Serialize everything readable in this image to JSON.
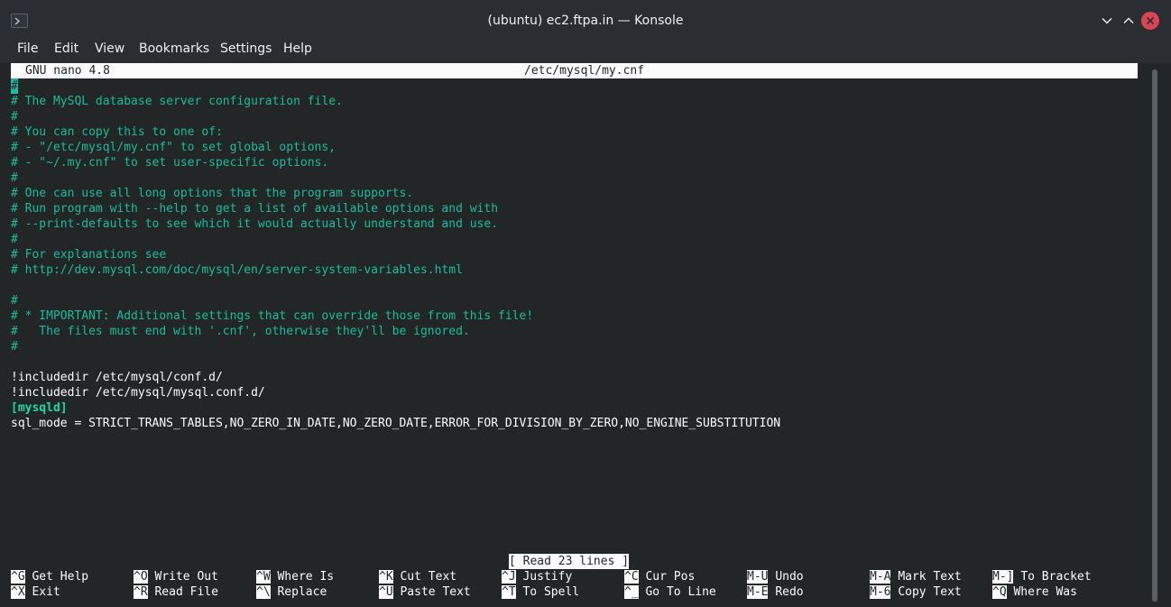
{
  "window": {
    "title": "(ubuntu) ec2.ftpa.in — Konsole"
  },
  "menu": [
    "File",
    "Edit",
    "View",
    "Bookmarks",
    "Settings",
    "Help"
  ],
  "nano": {
    "version": "GNU nano 4.8",
    "filename": "/etc/mysql/my.cnf",
    "status_message": "[ Read 23 lines ]"
  },
  "file_lines": {
    "l1": "#",
    "l2": "# The MySQL database server configuration file.",
    "l3": "#",
    "l4": "# You can copy this to one of:",
    "l5": "# - \"/etc/mysql/my.cnf\" to set global options,",
    "l6": "# - \"~/.my.cnf\" to set user-specific options.",
    "l7": "#",
    "l8": "# One can use all long options that the program supports.",
    "l9": "# Run program with --help to get a list of available options and with",
    "l10": "# --print-defaults to see which it would actually understand and use.",
    "l11": "#",
    "l12": "# For explanations see",
    "l13": "# http://dev.mysql.com/doc/mysql/en/server-system-variables.html",
    "l15": "#",
    "l16": "# * IMPORTANT: Additional settings that can override those from this file!",
    "l17": "#   The files must end with '.cnf', otherwise they'll be ignored.",
    "l18": "#",
    "l20": "!includedir /etc/mysql/conf.d/",
    "l21": "!includedir /etc/mysql/mysql.conf.d/",
    "l22": "[mysqld]",
    "l23": "sql_mode = STRICT_TRANS_TABLES,NO_ZERO_IN_DATE,NO_ZERO_DATE,ERROR_FOR_DIVISION_BY_ZERO,NO_ENGINE_SUBSTITUTION"
  },
  "shortcuts": {
    "row1": [
      {
        "key": "^G",
        "label": "Get Help"
      },
      {
        "key": "^O",
        "label": "Write Out"
      },
      {
        "key": "^W",
        "label": "Where Is"
      },
      {
        "key": "^K",
        "label": "Cut Text"
      },
      {
        "key": "^J",
        "label": "Justify"
      },
      {
        "key": "^C",
        "label": "Cur Pos"
      },
      {
        "key": "M-U",
        "label": "Undo"
      },
      {
        "key": "M-A",
        "label": "Mark Text"
      },
      {
        "key": "M-]",
        "label": "To Bracket"
      }
    ],
    "row2": [
      {
        "key": "^X",
        "label": "Exit"
      },
      {
        "key": "^R",
        "label": "Read File"
      },
      {
        "key": "^\\",
        "label": "Replace"
      },
      {
        "key": "^U",
        "label": "Paste Text"
      },
      {
        "key": "^T",
        "label": "To Spell"
      },
      {
        "key": "^_",
        "label": "Go To Line"
      },
      {
        "key": "M-E",
        "label": "Redo"
      },
      {
        "key": "M-6",
        "label": "Copy Text"
      },
      {
        "key": "^Q",
        "label": "Where Was"
      }
    ]
  },
  "colors": {
    "comment": "#1abc9c",
    "background": "#232627",
    "foreground": "#fcfcfc",
    "close_button": "#da4453"
  }
}
